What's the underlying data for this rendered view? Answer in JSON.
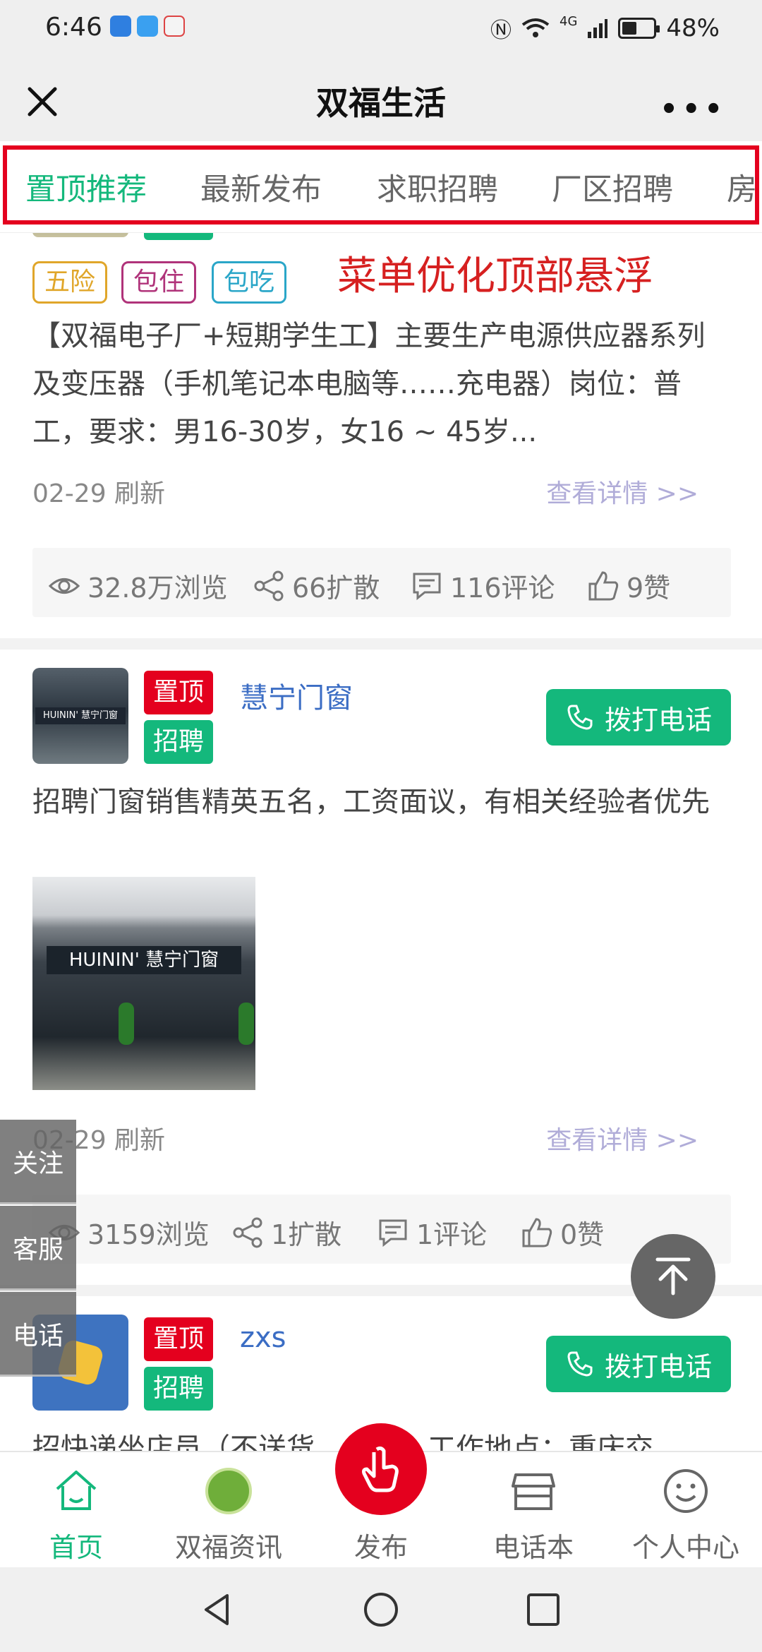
{
  "status_bar": {
    "time": "6:46",
    "battery": "48%",
    "battery_level": 0.48,
    "network": "4G"
  },
  "header": {
    "title": "双福生活",
    "more": "•••"
  },
  "tabs": [
    {
      "label": "置顶推荐",
      "active": true
    },
    {
      "label": "最新发布"
    },
    {
      "label": "求职招聘"
    },
    {
      "label": "厂区招聘"
    },
    {
      "label": "房"
    }
  ],
  "annotation": "菜单优化顶部悬浮",
  "post1": {
    "tags": [
      "五险",
      "包住",
      "包吃"
    ],
    "text": "【双福电子厂+短期学生工】主要生产电源供应器系列及变压器（手机笔记本电脑等……充电器）岗位：普工，要求：男16-30岁，女16 ~ 45岁...",
    "refreshed": "02-29 刷新",
    "detail_link": "查看详情 >>",
    "stats": {
      "views": "32.8万浏览",
      "shares": "66扩散",
      "comments": "116评论",
      "likes": "9赞"
    }
  },
  "post2": {
    "badge_top": "置顶",
    "badge_type": "招聘",
    "poster": "慧宁门窗",
    "call_label": "拨打电话",
    "text": "招聘门窗销售精英五名，工资面议，有相关经验者优先",
    "thumb_text": "HUININ' 慧宁门窗",
    "photo_text": "HUININ' 慧宁门窗",
    "refreshed": "02-29 刷新",
    "detail_link": "查看详情 >>",
    "stats": {
      "views": "3159浏览",
      "shares": "1扩散",
      "comments": "1评论",
      "likes": "0赞"
    }
  },
  "post3": {
    "badge_top": "置顶",
    "badge_type": "招聘",
    "poster": "zxs",
    "call_label": "拨打电话",
    "text": "招快递坐店员（不送货，坐店）工作地点：重庆交"
  },
  "side_panel": [
    "关注",
    "客服",
    "电话"
  ],
  "bottom_nav": [
    {
      "label": "首页",
      "icon": "home-icon",
      "active": true
    },
    {
      "label": "双福资讯",
      "icon": "news-icon"
    },
    {
      "label": "发布",
      "icon": "publish-hand-icon"
    },
    {
      "label": "电话本",
      "icon": "store-icon"
    },
    {
      "label": "个人中心",
      "icon": "smiley-icon"
    }
  ],
  "colors": {
    "accent_green": "#14b87c",
    "brand_red": "#e4001e",
    "link_blue": "#3b6dc4",
    "detail_purple": "#b0acd8"
  }
}
